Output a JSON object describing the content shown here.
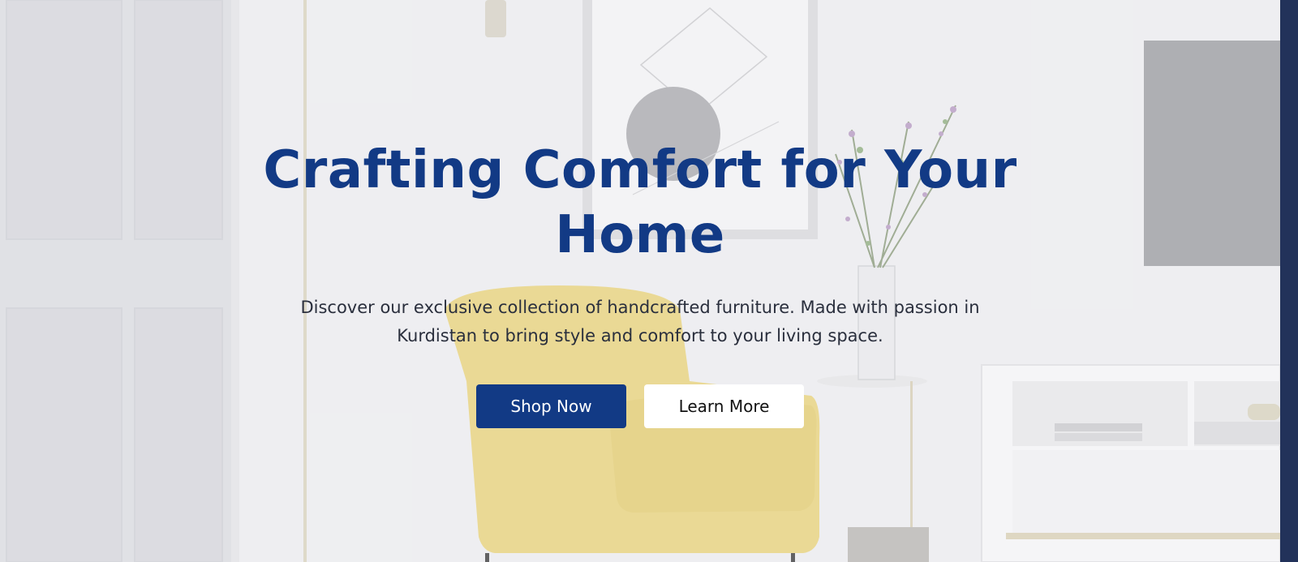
{
  "hero": {
    "title": "Crafting Comfort for Your Home",
    "description": "Discover our exclusive collection of handcrafted furniture. Made with passion in Kurdistan to bring style and comfort to your living space.",
    "primary_button": "Shop Now",
    "secondary_button": "Learn More"
  },
  "colors": {
    "brand": "#123a85",
    "text": "#2a2f3d",
    "side_bar": "#22325a",
    "armchair": "#e8d37a"
  }
}
